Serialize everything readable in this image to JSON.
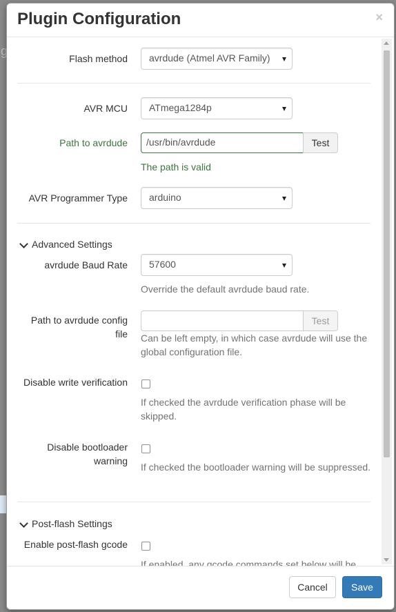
{
  "background": {
    "frag_left": "g"
  },
  "modal": {
    "title": "Plugin Configuration",
    "close_label": "×"
  },
  "form": {
    "flash_method": {
      "label": "Flash method",
      "value": "avrdude (Atmel AVR Family)"
    },
    "avr_mcu": {
      "label": "AVR MCU",
      "value": "ATmega1284p"
    },
    "path_avrdude": {
      "label": "Path to avrdude",
      "value": "/usr/bin/avrdude",
      "button": "Test",
      "status": "The path is valid"
    },
    "programmer_type": {
      "label": "AVR Programmer Type",
      "value": "arduino"
    },
    "advanced": {
      "title": "Advanced Settings"
    },
    "baud_rate": {
      "label": "avrdude Baud Rate",
      "value": "57600",
      "help": "Override the default avrdude baud rate."
    },
    "config_path": {
      "label_line1": "Path to avrdude config",
      "label_line2": "file",
      "value": "",
      "button": "Test",
      "help": "Can be left empty, in which case avrdude will use the global configuration file."
    },
    "disable_verification": {
      "label": "Disable write verification",
      "checked": false,
      "help": "If checked the avrdude verification phase will be skipped."
    },
    "disable_bootloader_warning": {
      "label_line1": "Disable bootloader",
      "label_line2": "warning",
      "checked": false,
      "help": "If checked the bootloader warning will be suppressed."
    },
    "post_flash": {
      "title": "Post-flash Settings"
    },
    "enable_post_flash_gcode": {
      "label": "Enable post-flash gcode",
      "checked": false,
      "help": "If enabled, any gcode commands set below will be"
    }
  },
  "footer": {
    "cancel_label": "Cancel",
    "save_label": "Save"
  },
  "colors": {
    "primary": "#337ab7",
    "success": "#3c763d"
  }
}
